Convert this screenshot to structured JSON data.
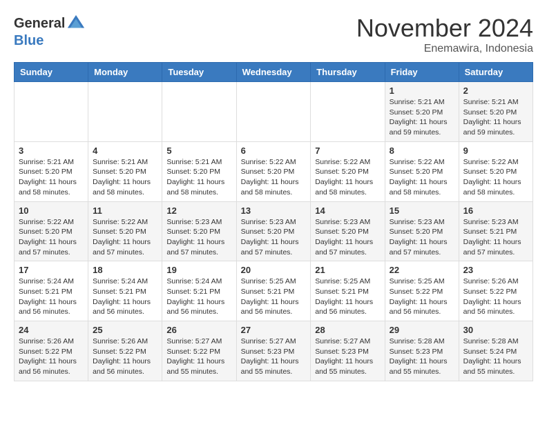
{
  "header": {
    "logo_general": "General",
    "logo_blue": "Blue",
    "month_title": "November 2024",
    "location": "Enemawira, Indonesia"
  },
  "weekdays": [
    "Sunday",
    "Monday",
    "Tuesday",
    "Wednesday",
    "Thursday",
    "Friday",
    "Saturday"
  ],
  "weeks": [
    [
      {
        "day": "",
        "info": ""
      },
      {
        "day": "",
        "info": ""
      },
      {
        "day": "",
        "info": ""
      },
      {
        "day": "",
        "info": ""
      },
      {
        "day": "",
        "info": ""
      },
      {
        "day": "1",
        "info": "Sunrise: 5:21 AM\nSunset: 5:20 PM\nDaylight: 11 hours and 59 minutes."
      },
      {
        "day": "2",
        "info": "Sunrise: 5:21 AM\nSunset: 5:20 PM\nDaylight: 11 hours and 59 minutes."
      }
    ],
    [
      {
        "day": "3",
        "info": "Sunrise: 5:21 AM\nSunset: 5:20 PM\nDaylight: 11 hours and 58 minutes."
      },
      {
        "day": "4",
        "info": "Sunrise: 5:21 AM\nSunset: 5:20 PM\nDaylight: 11 hours and 58 minutes."
      },
      {
        "day": "5",
        "info": "Sunrise: 5:21 AM\nSunset: 5:20 PM\nDaylight: 11 hours and 58 minutes."
      },
      {
        "day": "6",
        "info": "Sunrise: 5:22 AM\nSunset: 5:20 PM\nDaylight: 11 hours and 58 minutes."
      },
      {
        "day": "7",
        "info": "Sunrise: 5:22 AM\nSunset: 5:20 PM\nDaylight: 11 hours and 58 minutes."
      },
      {
        "day": "8",
        "info": "Sunrise: 5:22 AM\nSunset: 5:20 PM\nDaylight: 11 hours and 58 minutes."
      },
      {
        "day": "9",
        "info": "Sunrise: 5:22 AM\nSunset: 5:20 PM\nDaylight: 11 hours and 58 minutes."
      }
    ],
    [
      {
        "day": "10",
        "info": "Sunrise: 5:22 AM\nSunset: 5:20 PM\nDaylight: 11 hours and 57 minutes."
      },
      {
        "day": "11",
        "info": "Sunrise: 5:22 AM\nSunset: 5:20 PM\nDaylight: 11 hours and 57 minutes."
      },
      {
        "day": "12",
        "info": "Sunrise: 5:23 AM\nSunset: 5:20 PM\nDaylight: 11 hours and 57 minutes."
      },
      {
        "day": "13",
        "info": "Sunrise: 5:23 AM\nSunset: 5:20 PM\nDaylight: 11 hours and 57 minutes."
      },
      {
        "day": "14",
        "info": "Sunrise: 5:23 AM\nSunset: 5:20 PM\nDaylight: 11 hours and 57 minutes."
      },
      {
        "day": "15",
        "info": "Sunrise: 5:23 AM\nSunset: 5:20 PM\nDaylight: 11 hours and 57 minutes."
      },
      {
        "day": "16",
        "info": "Sunrise: 5:23 AM\nSunset: 5:21 PM\nDaylight: 11 hours and 57 minutes."
      }
    ],
    [
      {
        "day": "17",
        "info": "Sunrise: 5:24 AM\nSunset: 5:21 PM\nDaylight: 11 hours and 56 minutes."
      },
      {
        "day": "18",
        "info": "Sunrise: 5:24 AM\nSunset: 5:21 PM\nDaylight: 11 hours and 56 minutes."
      },
      {
        "day": "19",
        "info": "Sunrise: 5:24 AM\nSunset: 5:21 PM\nDaylight: 11 hours and 56 minutes."
      },
      {
        "day": "20",
        "info": "Sunrise: 5:25 AM\nSunset: 5:21 PM\nDaylight: 11 hours and 56 minutes."
      },
      {
        "day": "21",
        "info": "Sunrise: 5:25 AM\nSunset: 5:21 PM\nDaylight: 11 hours and 56 minutes."
      },
      {
        "day": "22",
        "info": "Sunrise: 5:25 AM\nSunset: 5:22 PM\nDaylight: 11 hours and 56 minutes."
      },
      {
        "day": "23",
        "info": "Sunrise: 5:26 AM\nSunset: 5:22 PM\nDaylight: 11 hours and 56 minutes."
      }
    ],
    [
      {
        "day": "24",
        "info": "Sunrise: 5:26 AM\nSunset: 5:22 PM\nDaylight: 11 hours and 56 minutes."
      },
      {
        "day": "25",
        "info": "Sunrise: 5:26 AM\nSunset: 5:22 PM\nDaylight: 11 hours and 56 minutes."
      },
      {
        "day": "26",
        "info": "Sunrise: 5:27 AM\nSunset: 5:22 PM\nDaylight: 11 hours and 55 minutes."
      },
      {
        "day": "27",
        "info": "Sunrise: 5:27 AM\nSunset: 5:23 PM\nDaylight: 11 hours and 55 minutes."
      },
      {
        "day": "28",
        "info": "Sunrise: 5:27 AM\nSunset: 5:23 PM\nDaylight: 11 hours and 55 minutes."
      },
      {
        "day": "29",
        "info": "Sunrise: 5:28 AM\nSunset: 5:23 PM\nDaylight: 11 hours and 55 minutes."
      },
      {
        "day": "30",
        "info": "Sunrise: 5:28 AM\nSunset: 5:24 PM\nDaylight: 11 hours and 55 minutes."
      }
    ]
  ]
}
